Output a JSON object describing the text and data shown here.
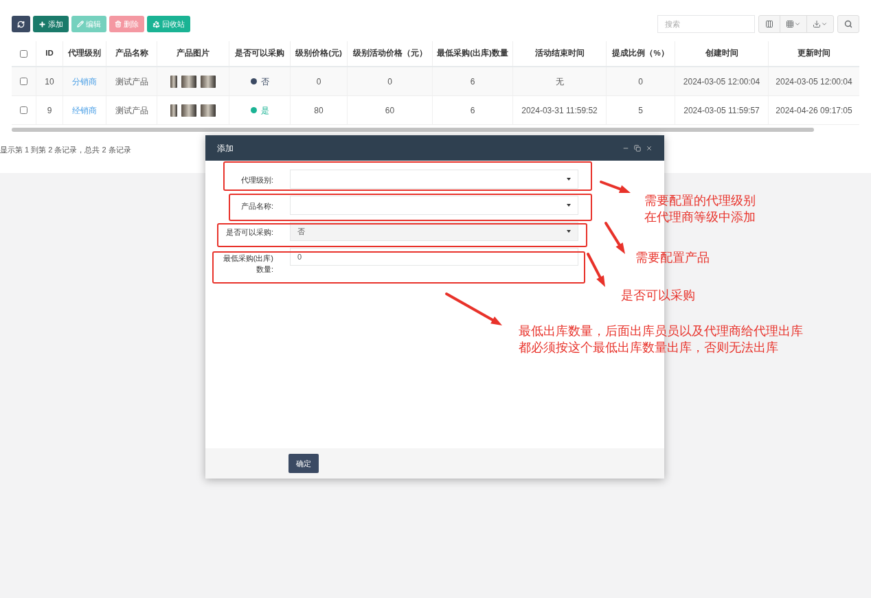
{
  "toolbar": {
    "buttons": [
      {
        "kind": "refresh",
        "disabled": false
      },
      {
        "kind": "add",
        "label": "添加",
        "disabled": false
      },
      {
        "kind": "edit",
        "label": "编辑",
        "disabled": true
      },
      {
        "kind": "delete",
        "label": "删除",
        "disabled": true
      },
      {
        "kind": "recycle",
        "label": "回收站",
        "disabled": false
      }
    ],
    "search": {
      "placeholder": "搜索"
    }
  },
  "table": {
    "select_all_checked": false,
    "columns": [
      "ID",
      "代理级别",
      "产品名称",
      "产品图片",
      "是否可以采购",
      "级别价格(元)",
      "级别活动价格（元）",
      "最低采购(出库)数量",
      "活动结束时间",
      "提成比例（%）",
      "创建时间",
      "更新时间"
    ],
    "rows": [
      {
        "checked": false,
        "id": "10",
        "level": "分销商",
        "product": "测试产品",
        "purchasable": {
          "label": "否",
          "color": "#3b4a63"
        },
        "price": "0",
        "activity_price": "0",
        "min_qty": "6",
        "end_time": "无",
        "commission": "0",
        "created": "2024-03-05 12:00:04",
        "updated": "2024-03-05 12:00:04"
      },
      {
        "checked": false,
        "id": "9",
        "level": "经销商",
        "product": "测试产品",
        "purchasable": {
          "label": "是",
          "color": "#1ab394"
        },
        "price": "80",
        "activity_price": "60",
        "min_qty": "6",
        "end_time": "2024-03-31 11:59:52",
        "commission": "5",
        "created": "2024-03-05 11:59:57",
        "updated": "2024-04-26 09:17:05"
      }
    ]
  },
  "pagination_info": "显示第 1 到第 2 条记录，总共 2 条记录",
  "dialog": {
    "title": "添加",
    "fields": [
      {
        "kind": "select",
        "label": "代理级别:",
        "disabled": false
      },
      {
        "kind": "select",
        "label": "产品名称:",
        "disabled": false
      },
      {
        "kind": "select",
        "label": "是否可以采购:",
        "value": "否",
        "disabled": true
      },
      {
        "kind": "input",
        "label": "最低采购(出库)数量:",
        "value": "0",
        "disabled": false
      }
    ],
    "confirm": "确定"
  },
  "annotations": [
    {
      "lines": [
        "需要配置的代理级别",
        "在代理商等级中添加"
      ]
    },
    {
      "lines": [
        "需要配置产品"
      ]
    },
    {
      "lines": [
        "是否可以采购"
      ]
    },
    {
      "lines": [
        "最低出库数量，后面出库员员以及代理商给代理出库",
        "都必须按这个最低出库数量出库，否则无法出库"
      ]
    }
  ]
}
